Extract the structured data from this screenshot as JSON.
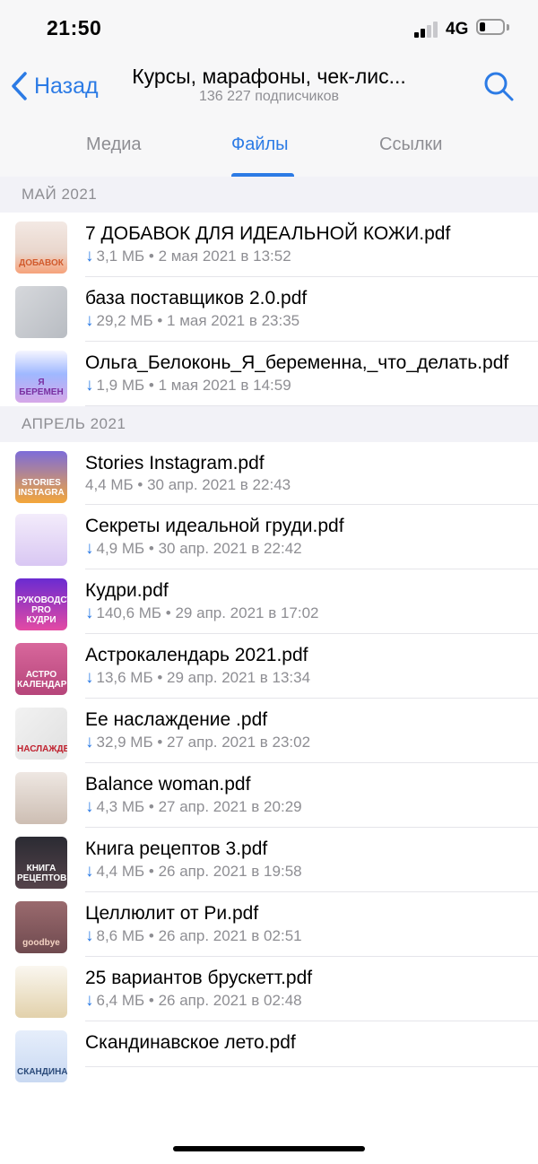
{
  "status": {
    "time": "21:50",
    "network": "4G"
  },
  "header": {
    "back_label": "Назад",
    "title": "Курсы, марафоны, чек-лис...",
    "subtitle": "136 227 подписчиков"
  },
  "tabs": [
    {
      "label": "Медиа"
    },
    {
      "label": "Файлы"
    },
    {
      "label": "Ссылки"
    }
  ],
  "sections": [
    {
      "title": "МАЙ 2021",
      "items": [
        {
          "name": "7 ДОБАВОК ДЛЯ ИДЕАЛЬНОЙ КОЖИ.pdf",
          "meta": "3,1 МБ • 2 мая 2021 в 13:52",
          "download": "↓"
        },
        {
          "name": "база поставщиков 2.0.pdf",
          "meta": "29,2 МБ • 1 мая 2021 в 23:35",
          "download": "↓"
        },
        {
          "name": "Ольга_Белоконь_Я_беременна,_что_делать.pdf",
          "meta": "1,9 МБ • 1 мая 2021 в 14:59",
          "download": "↓"
        }
      ]
    },
    {
      "title": "АПРЕЛЬ 2021",
      "items": [
        {
          "name": "Stories Instagram.pdf",
          "meta": "4,4 МБ • 30 апр. 2021 в 22:43",
          "download": ""
        },
        {
          "name": "Секреты идеальной груди.pdf",
          "meta": "4,9 МБ • 30 апр. 2021 в 22:42",
          "download": "↓"
        },
        {
          "name": "Кудри.pdf",
          "meta": "140,6 МБ • 29 апр. 2021 в 17:02",
          "download": "↓"
        },
        {
          "name": "Астрокалендарь 2021.pdf",
          "meta": "13,6 МБ • 29 апр. 2021 в 13:34",
          "download": "↓"
        },
        {
          "name": "Ее наслаждение .pdf",
          "meta": "32,9 МБ • 27 апр. 2021 в 23:02",
          "download": "↓"
        },
        {
          "name": "Balance woman.pdf",
          "meta": "4,3 МБ • 27 апр. 2021 в 20:29",
          "download": "↓"
        },
        {
          "name": "Книга рецептов 3.pdf",
          "meta": "4,4 МБ • 26 апр. 2021 в 19:58",
          "download": "↓"
        },
        {
          "name": "Целлюлит от Ри.pdf",
          "meta": "8,6 МБ • 26 апр. 2021 в 02:51",
          "download": "↓"
        },
        {
          "name": "25 вариантов брускетт.pdf",
          "meta": "6,4 МБ • 26 апр. 2021 в 02:48",
          "download": "↓"
        },
        {
          "name": "Скандинавское лето.pdf",
          "meta": "",
          "download": ""
        }
      ]
    }
  ],
  "thumbs": [
    {
      "bg": "linear-gradient(180deg,#f3e9e4 0%,#e9d6cc 60%,#f6a27a 100%)",
      "text": "ДОБАВОК",
      "color": "#d25a2c"
    },
    {
      "bg": "linear-gradient(135deg,#d6d8dc,#b8bcc2)",
      "text": "",
      "color": "#fff"
    },
    {
      "bg": "linear-gradient(180deg,#f5f5ff 0%,#9fb8ff 45%,#d6a7e8 100%)",
      "text": "Я БЕРЕМЕН",
      "color": "#7a2fa0"
    },
    {
      "bg": "linear-gradient(180deg,#7d6cd9 0%,#f4a63a 100%)",
      "text": "STORIES INSTAGRA",
      "color": "#fff"
    },
    {
      "bg": "linear-gradient(180deg,#f3ecfb,#d9c7f3)",
      "text": "",
      "color": "#7d53b8"
    },
    {
      "bg": "linear-gradient(180deg,#6a2bd1,#e44aa4)",
      "text": "РУКОВОДСТВО PRO КУДРИ",
      "color": "#fff"
    },
    {
      "bg": "linear-gradient(180deg,#d8679c,#b6457a)",
      "text": "АСТРО КАЛЕНДАРЬ",
      "color": "#fff"
    },
    {
      "bg": "linear-gradient(135deg,#f2f2f2,#e0e0e0)",
      "text": "НАСЛАЖДЕН",
      "color": "#c0212e"
    },
    {
      "bg": "linear-gradient(180deg,#eee7e2,#cdbeb3)",
      "text": "",
      "color": "#333"
    },
    {
      "bg": "linear-gradient(180deg,#2b2b33,#55434a)",
      "text": "КНИГА РЕЦЕПТОВ",
      "color": "#fff"
    },
    {
      "bg": "linear-gradient(180deg,#9a6a6e,#6f4a4f)",
      "text": "goodbye",
      "color": "#f3d2c2"
    },
    {
      "bg": "linear-gradient(180deg,#faf7f0,#e2d1ab)",
      "text": "",
      "color": "#7b6a40"
    },
    {
      "bg": "linear-gradient(180deg,#e6eefb,#c9d9f2)",
      "text": "СКАНДИНАВСКО",
      "color": "#2a4a7a"
    }
  ]
}
